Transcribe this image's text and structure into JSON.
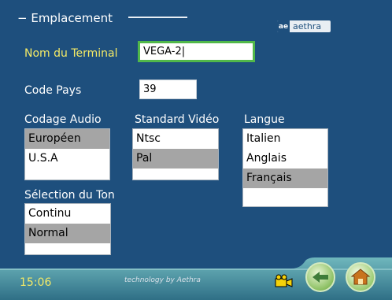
{
  "screen": {
    "section_title": "Emplacement",
    "brand": {
      "name": "aethra",
      "mark": "ae"
    }
  },
  "form": {
    "terminal_name_label": "Nom du Terminal",
    "terminal_name_value": "VEGA-2|",
    "country_code_label": "Code Pays",
    "country_code_value": "39"
  },
  "audio_coding": {
    "label": "Codage Audio",
    "options": [
      {
        "label": "Européen",
        "selected": true
      },
      {
        "label": "U.S.A",
        "selected": false
      }
    ]
  },
  "video_standard": {
    "label": "Standard Vidéo",
    "options": [
      {
        "label": "Ntsc",
        "selected": false
      },
      {
        "label": "Pal",
        "selected": true
      }
    ]
  },
  "language": {
    "label": "Langue",
    "options": [
      {
        "label": "Italien",
        "selected": false
      },
      {
        "label": "Anglais",
        "selected": false
      },
      {
        "label": "Français",
        "selected": true
      }
    ]
  },
  "tone_selection": {
    "label": "Sélection du Ton",
    "options": [
      {
        "label": "Continu",
        "selected": false
      },
      {
        "label": "Normal",
        "selected": true
      }
    ]
  },
  "footer": {
    "time": "15:06",
    "tagline": "technology by Aethra",
    "icons": [
      "video-camera-icon",
      "back-arrow-icon",
      "home-icon"
    ]
  },
  "colors": {
    "background": "#1e4f7d",
    "accent_yellow": "#f4ea66",
    "focus_green": "#51b84a",
    "selection_gray": "#a5a5a5",
    "bar_teal": "#4f9fa6"
  }
}
